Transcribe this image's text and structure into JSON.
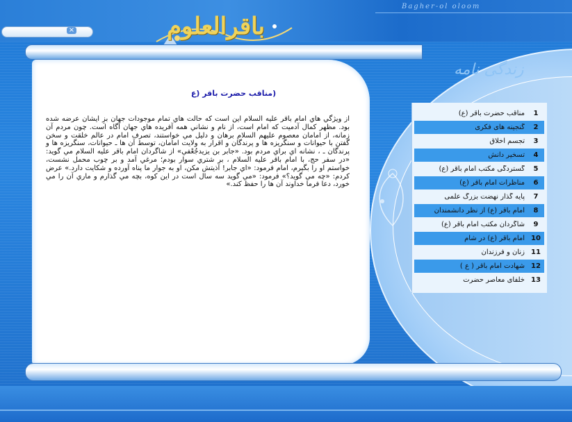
{
  "header": {
    "brand_en": "Bagher-ol oloom",
    "logo_text": "باقرالعلوم",
    "search_close_icon": "close-icon"
  },
  "sidebar": {
    "title": "زندگی نامه",
    "items": [
      {
        "num": "1",
        "label": "مناقب حضرت باقر (ع)",
        "highlighted": false
      },
      {
        "num": "2",
        "label": "گنجینه های فکری",
        "highlighted": true
      },
      {
        "num": "3",
        "label": "تجسم اخلاق",
        "highlighted": false
      },
      {
        "num": "4",
        "label": "تسخیر دانش",
        "highlighted": true
      },
      {
        "num": "5",
        "label": "گستردگی مکتب امام باقر (ع)",
        "highlighted": false
      },
      {
        "num": "6",
        "label": "مناظرات امام باقر (ع)",
        "highlighted": true
      },
      {
        "num": "7",
        "label": "پایه گذار نهضت بزرگ علمی",
        "highlighted": false
      },
      {
        "num": "8",
        "label": "امام باقر (ع) از نظر دانشمندان",
        "highlighted": true
      },
      {
        "num": "9",
        "label": "شاگردان مکتب امام باقر (ع)",
        "highlighted": false
      },
      {
        "num": "10",
        "label": "امام باقر (ع) در شام",
        "highlighted": true
      },
      {
        "num": "11",
        "label": "زنان و فرزندان",
        "highlighted": false
      },
      {
        "num": "12",
        "label": "شهادت امام باقر ( ع )",
        "highlighted": true
      },
      {
        "num": "13",
        "label": "خلفای معاصر حضرت",
        "highlighted": false
      }
    ]
  },
  "main": {
    "title": "(مناقب حضرت باقر (ع",
    "body": "از ويژگي هاي امام باقر عليه السلام اين است كه حالت هاي تمام موجودات جهان بزِ ايشان عرضه شده بود. مظهر كمال آدميت كه امام است، از نام و نشاني همه آفريده هاي جهان آگاه است. چون مردم آن زمانه، از امامان معصوم عليهم السلام برهان و دليل مي خواستند، تصرف امام در عالم خلقت و سخن گفتن با حيوانات و سنگريزه ها و پرندگان و اقرار به ولايت امامان، توسط آن ها ـ حيوانات، سنگريزه ها و پرندگان ـ ، نشانه اي براي مردم بود. «جابر بن يزيدجُعْفي» از شاگردان امام باقر عليه السلام مي گويد: «در سفر حج، با امام باقر عليه السلام ، بر شتري سوار بودم؛ مرغي آمد و بر چوب محمل نشست، خواستم او را بگيرم، امام فرمود: «اي جابر! آذيتش مكن، او به جوار ما پناه آورده و شكايت دارد.» عرض كردم: «چه مي گويد؟» فرمود: «مي گويد سه سال است در اين كوه، بچه مي گذارم و ماري آن را مي خورد، دعا فرما خداوند آن ها را حفظ كند.»"
  },
  "colors": {
    "background": "#2a86e0",
    "menu_highlight": "#3a9aea",
    "title_text": "#1c1caa"
  }
}
